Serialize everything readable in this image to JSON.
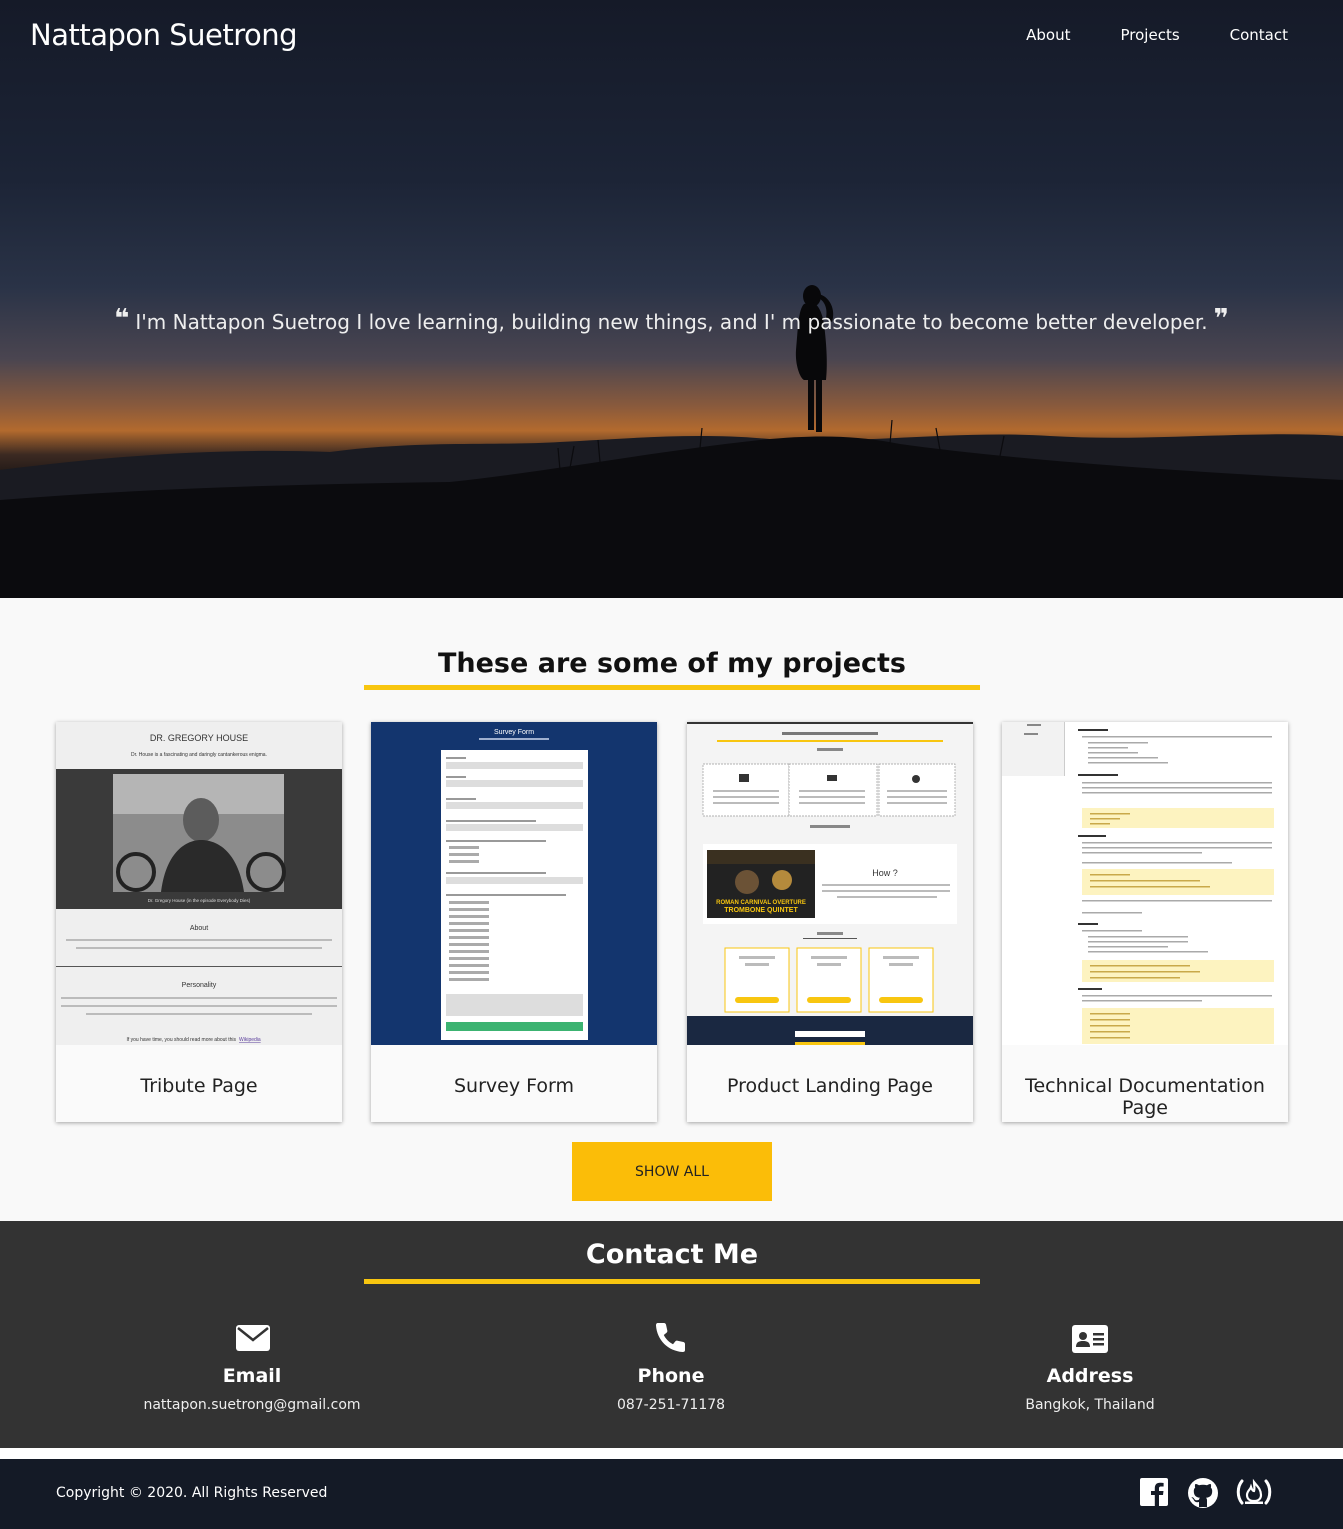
{
  "header": {
    "brand": "Nattapon Suetrong",
    "nav": [
      {
        "label": "About"
      },
      {
        "label": "Projects"
      },
      {
        "label": "Contact"
      }
    ]
  },
  "hero": {
    "quote": "I'm Nattapon Suetrog I love learning, building new things, and I' m passionate to become better developer.",
    "open_mark": "❝",
    "close_mark": "❞"
  },
  "projects": {
    "title": "These are some of my projects",
    "cards": [
      {
        "caption": "Tribute Page"
      },
      {
        "caption": "Survey Form"
      },
      {
        "caption": "Product Landing Page"
      },
      {
        "caption": "Technical Documentation Page"
      }
    ],
    "show_all": "SHOW ALL",
    "thumbs": {
      "tribute": {
        "title": "DR. GREGORY HOUSE",
        "subtitle": "Dr. House is a fascinating and daringly cantankerous enigma.",
        "photo_caption": "Dr. Gregory House (in the episode Everybody Dies)",
        "about": "About",
        "personality": "Personality",
        "footer_text": "If you have time, you should read more about this",
        "footer_link": "Wikipedia"
      },
      "survey": {
        "title": "Survey Form"
      },
      "landing": {
        "how": "How ?",
        "video_line1": "ROMAN CARNIVAL OVERTURE",
        "video_line2": "TROMBONE QUINTET"
      }
    }
  },
  "contact": {
    "title": "Contact Me",
    "items": [
      {
        "icon": "envelope-icon",
        "label": "Email",
        "value": "nattapon.suetrong@gmail.com"
      },
      {
        "icon": "phone-icon",
        "label": "Phone",
        "value": "087-251-71178"
      },
      {
        "icon": "address-card-icon",
        "label": "Address",
        "value": "Bangkok, Thailand"
      }
    ]
  },
  "footer": {
    "copyright": "Copyright © 2020. All Rights Reserved",
    "social": [
      "facebook-icon",
      "github-icon",
      "freecodecamp-icon"
    ]
  },
  "colors": {
    "accent": "#f8c610",
    "button": "#fbbd08",
    "contact_bg": "#333333",
    "footer_bg": "#141a26",
    "survey_bg": "#13356e"
  }
}
